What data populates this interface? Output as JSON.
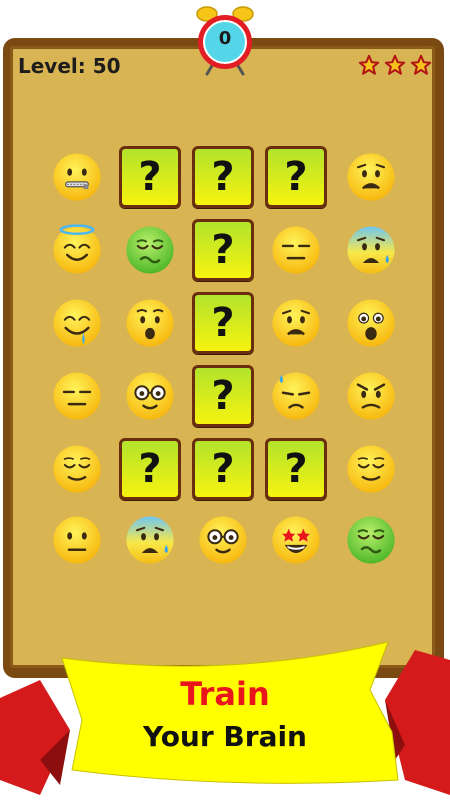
{
  "timer": {
    "value": "0"
  },
  "header": {
    "level_label": "Level: 50",
    "stars_count": 3
  },
  "colors": {
    "frame": "#7a4a12",
    "board": "#d8b452",
    "banner_red": "#d41a1a",
    "banner_yellow": "#ffff00",
    "tile_border": "#6a2e0e",
    "title_red": "#e8161c"
  },
  "grid": {
    "rows": [
      [
        "zipper-mouth-face",
        "hidden",
        "hidden",
        "hidden",
        "worried-face"
      ],
      [
        "smiling-face-with-halo",
        "nauseated-face",
        "hidden",
        "expressionless-face",
        "anxious-face-with-sweat"
      ],
      [
        "drooling-face",
        "hushed-face",
        "hidden",
        "worried-face",
        "astonished-face"
      ],
      [
        "expressionless-face",
        "nerd-face",
        "hidden",
        "downcast-face-with-sweat",
        "angry-face"
      ],
      [
        "relieved-face",
        "hidden",
        "hidden",
        "hidden",
        "relieved-face"
      ],
      [
        "neutral-face",
        "anxious-face-with-sweat",
        "nerd-face",
        "star-struck-face",
        "nauseated-face"
      ]
    ],
    "hidden_symbol": "?"
  },
  "banner": {
    "line1": "Train",
    "line2": "Your Brain"
  }
}
